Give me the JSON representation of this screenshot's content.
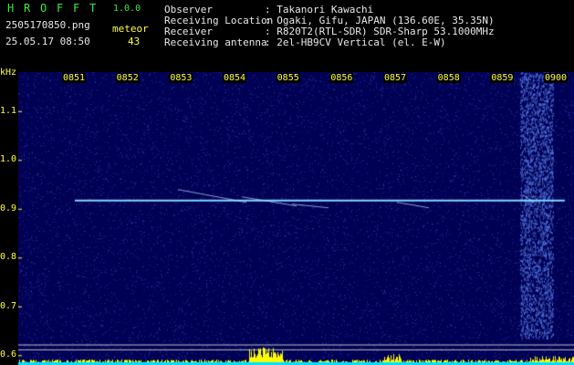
{
  "header": {
    "app_letters": [
      "H",
      "R",
      "O",
      "F",
      "F",
      "T"
    ],
    "version": "1.0.0",
    "filename": "2505170850.png",
    "datetime": "25.05.17 08:50",
    "category_label": "meteor",
    "count": "43",
    "info_keys": [
      "Observer",
      "Receiving Location",
      "Receiver",
      "Receiving antenna"
    ],
    "info_values": [
      ": Takanori Kawachi",
      ": Ogaki, Gifu, JAPAN (136.60E, 35.35N)",
      ": R820T2(RTL-SDR) SDR-Sharp 53.1000MHz",
      ": 2el-HB9CV Vertical (el. E-W)"
    ]
  },
  "chart_data": {
    "type": "heatmap",
    "ylabel": "kHz",
    "y_ticks": [
      "1.1",
      "1.0",
      "0.9",
      "0.8",
      "0.7",
      "0.6"
    ],
    "x_ticks": [
      "0851",
      "0852",
      "0853",
      "0854",
      "0855",
      "0856",
      "0857",
      "0858",
      "0859",
      "0900"
    ],
    "ylim": [
      0.58,
      1.18
    ],
    "carrier_khz": 0.917,
    "colors": {
      "background": "#000054",
      "noise": "#2a3cc8",
      "carrier": "#7fd8ff",
      "tick": "#ffff40",
      "level": "#ffff00",
      "level_base": "#00e0ff"
    }
  }
}
